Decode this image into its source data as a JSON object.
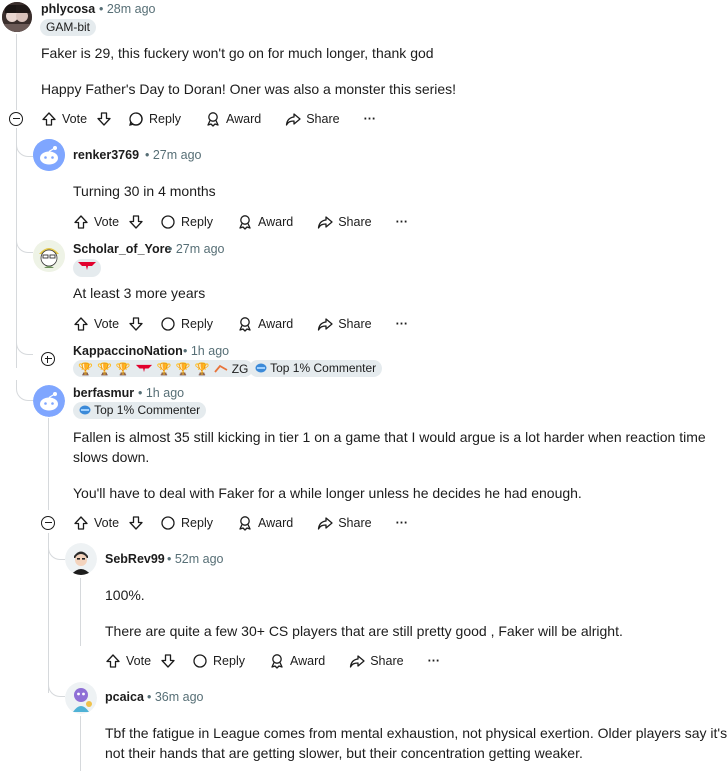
{
  "actions": {
    "vote": "Vote",
    "reply": "Reply",
    "award": "Award",
    "share": "Share",
    "more": "···"
  },
  "comments": [
    {
      "username": "phlycosa",
      "time": "28m ago",
      "flair": "GAM-bit",
      "body": [
        "Faker is 29, this fuckery won't go on for much longer, thank god",
        "Happy Father's Day to Doran! Oner was also a monster this series!"
      ]
    },
    {
      "username": "renker3769",
      "time": "27m ago",
      "body": [
        "Turning 30 in 4 months"
      ]
    },
    {
      "username": "Scholar_of_Yore",
      "time": "27m ago",
      "body": [
        "At least 3 more years"
      ]
    },
    {
      "username": "KappaccinoNation",
      "time": "1h ago",
      "flair_text": "ZG",
      "badge": "Top 1% Commenter"
    },
    {
      "username": "berfasmur",
      "time": "1h ago",
      "badge": "Top 1% Commenter",
      "body": [
        "Fallen is almost 35 still kicking in tier 1 on a game that I would argue is a lot harder when reaction time",
        "slows down.",
        "You'll have to deal with Faker for a while longer unless he decides he had enough."
      ]
    },
    {
      "username": "SebRev99",
      "time": "52m ago",
      "body": [
        "100%.",
        "There are quite a few 30+ CS players that are still pretty good , Faker will be alright."
      ]
    },
    {
      "username": "pcaica",
      "time": "36m ago",
      "body": [
        "Tbf the fatigue in League comes from mental exhaustion, not physical exertion. Older players say it's",
        "not their hands that are getting slower, but their concentration getting weaker."
      ]
    }
  ]
}
